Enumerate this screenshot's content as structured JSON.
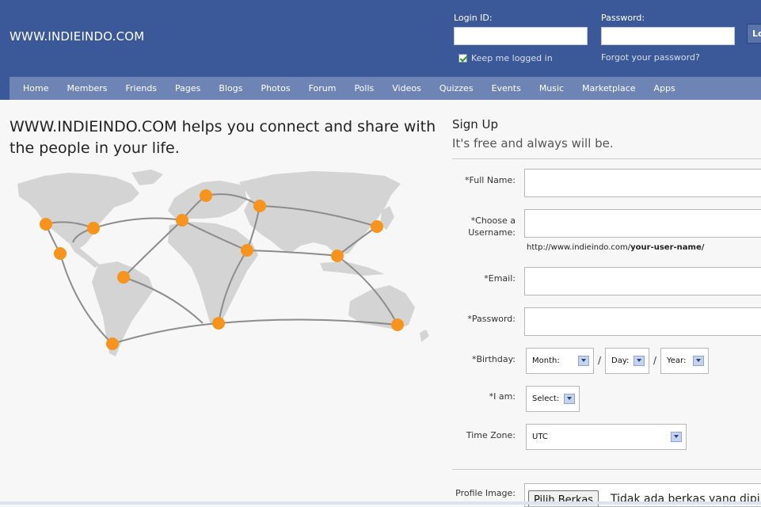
{
  "header": {
    "brand": "WWW.INDIEINDO.COM",
    "login_id_label": "Login ID:",
    "password_label": "Password:",
    "keep_logged_in": "Keep me logged in",
    "forgot_password": "Forgot your password?",
    "login_button": "Lo"
  },
  "nav": [
    "Home",
    "Members",
    "Friends",
    "Pages",
    "Blogs",
    "Photos",
    "Forum",
    "Polls",
    "Videos",
    "Quizzes",
    "Events",
    "Music",
    "Marketplace",
    "Apps"
  ],
  "main": {
    "tagline": "WWW.INDIEINDO.COM helps you connect and share with the people in your life."
  },
  "signup": {
    "title": "Sign Up",
    "subtitle": "It's free and always will be.",
    "full_name_label": "*Full Name:",
    "username_label": "*Choose a Username:",
    "url_prefix": "http://www.indieindo.com/",
    "url_suffix": "your-user-name/",
    "email_label": "*Email:",
    "password_label": "*Password:",
    "birthday_label": "*Birthday:",
    "month": "Month:",
    "day": "Day:",
    "year": "Year:",
    "slash": "/",
    "iam_label": "*I am:",
    "iam_value": "Select:",
    "timezone_label": "Time Zone:",
    "timezone_value": "UTC",
    "profile_image_label": "Profile Image:",
    "file_button": "Pilih Berkas",
    "file_status": "Tidak ada berkas yang dipilih"
  },
  "colors": {
    "header_bg": "#3b5998",
    "nav_bg": "#6d84b4",
    "marker": "#f7941d"
  }
}
